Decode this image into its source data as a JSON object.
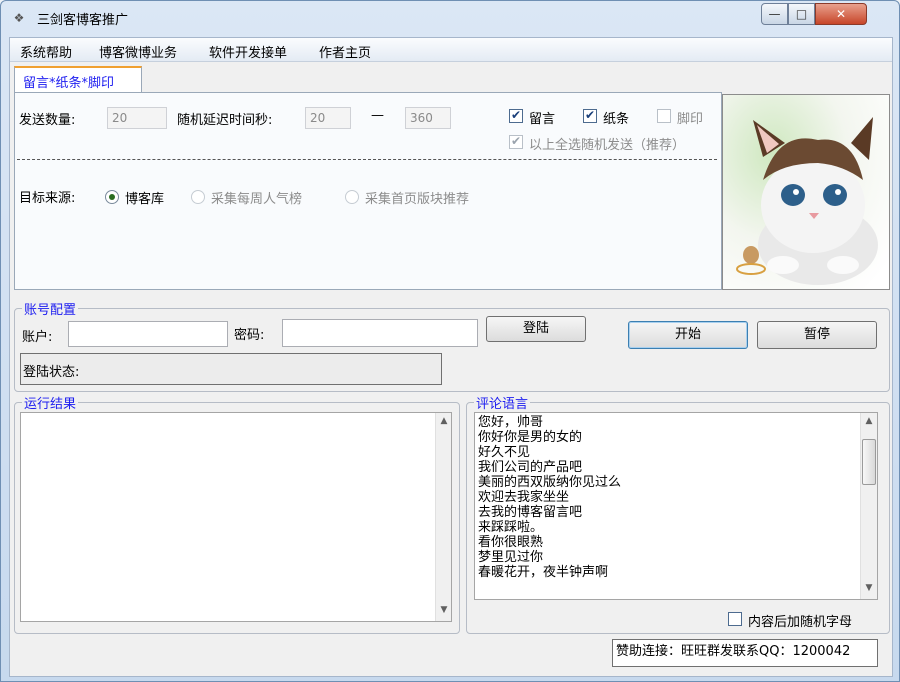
{
  "window": {
    "title": "三剑客博客推广"
  },
  "menu": [
    "系统帮助",
    "博客微博业务",
    "软件开发接单",
    "作者主页"
  ],
  "tab": {
    "label": "留言*纸条*脚印"
  },
  "send": {
    "count_label": "发送数量:",
    "count_value": "20",
    "delay_label": "随机延迟时间秒:",
    "delay_min": "20",
    "delay_dash": "—",
    "delay_max": "360"
  },
  "options": {
    "message": "留言",
    "note": "纸条",
    "footprint": "脚印",
    "random_all": "以上全选随机发送（推荐）"
  },
  "target": {
    "label": "目标来源:",
    "option_blog": "博客库",
    "option_weekly": "采集每周人气榜",
    "option_home": "采集首页版块推荐"
  },
  "account": {
    "group_title": "账号配置",
    "user_label": "账户:",
    "password_label": "密码:",
    "login_button": "登陆",
    "status_label": "登陆状态:"
  },
  "controls": {
    "start": "开始",
    "pause": "暂停"
  },
  "results": {
    "group_title": "运行结果"
  },
  "comments": {
    "group_title": "评论语言",
    "lines": [
      "您好，帅哥",
      "你好你是男的女的",
      "好久不见",
      "我们公司的产品吧",
      "美丽的西双版纳你见过么",
      "欢迎去我家坐坐",
      "去我的博客留言吧",
      "来踩踩啦。",
      "看你很眼熟",
      "梦里见过你",
      "春暖花开，夜半钟声啊"
    ],
    "random_suffix": "内容后加随机字母"
  },
  "sponsor": {
    "text": "赞助连接：旺旺群发联系QQ：1200042"
  }
}
